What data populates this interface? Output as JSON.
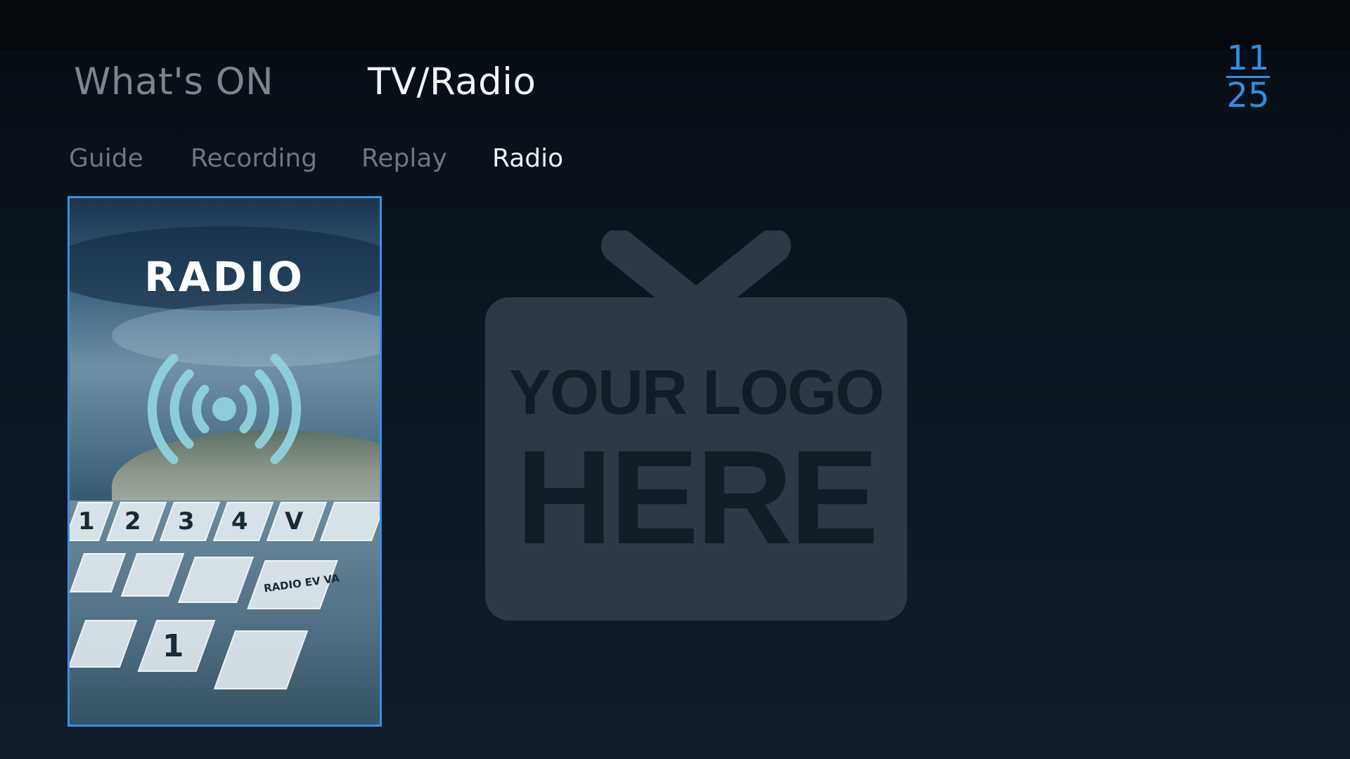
{
  "main_nav": {
    "tabs": [
      {
        "label": "What's ON",
        "active": false
      },
      {
        "label": "TV/Radio",
        "active": true
      }
    ]
  },
  "clock": {
    "hour": "11",
    "minute": "25",
    "color": "#2f8fe4"
  },
  "sub_nav": {
    "tabs": [
      {
        "label": "Guide",
        "active": false
      },
      {
        "label": "Recording",
        "active": false
      },
      {
        "label": "Replay",
        "active": false
      },
      {
        "label": "Radio",
        "active": true
      }
    ]
  },
  "content": {
    "poster": {
      "title": "RADIO",
      "icon": "radio-signal-icon",
      "tile_labels": [
        "1",
        "2",
        "3",
        "4",
        "V",
        "1",
        "RADIO EV VA"
      ]
    },
    "logo_placeholder": {
      "line1": "YOUR LOGO",
      "line2": "HERE",
      "icon": "tv-icon"
    }
  },
  "colors": {
    "focus_border": "#3a8fe0",
    "active_text": "#f2f4f6",
    "inactive_text": "#7d848c"
  }
}
